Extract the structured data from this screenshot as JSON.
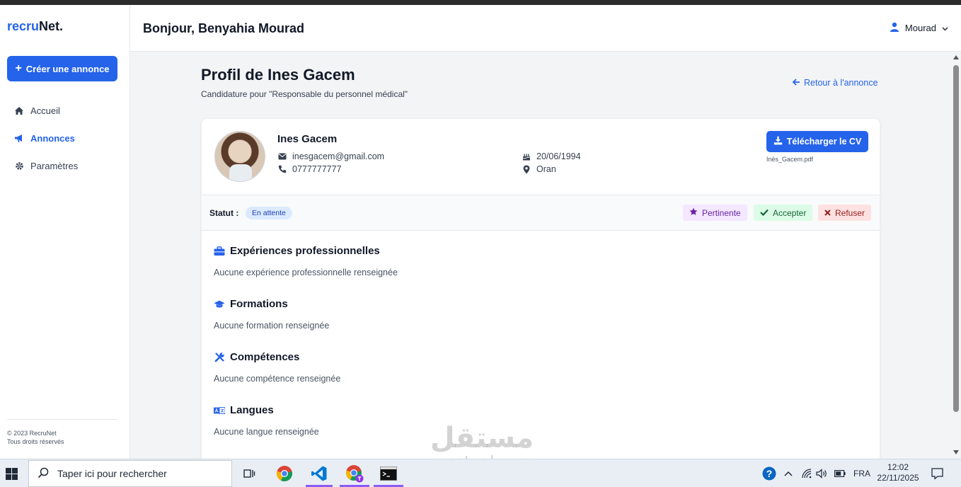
{
  "brand": {
    "part1": "recru",
    "part2": "Net."
  },
  "sidebar": {
    "create_label": "Créer une annonce",
    "items": [
      {
        "label": "Accueil",
        "icon": "home-icon"
      },
      {
        "label": "Annonces",
        "icon": "megaphone-icon",
        "active": true
      },
      {
        "label": "Paramètres",
        "icon": "gear-icon"
      }
    ],
    "footer_line1": "© 2023 RecruNet",
    "footer_line2": "Tous droits réservés"
  },
  "header": {
    "greeting": "Bonjour, Benyahia Mourad",
    "user": "Mourad"
  },
  "page": {
    "title": "Profil de Ines Gacem",
    "subtitle": "Candidature pour \"Responsable du personnel médical\"",
    "back_label": "Retour à l'annonce"
  },
  "candidate": {
    "name": "Ines Gacem",
    "email": "inesgacem@gmail.com",
    "phone": "0777777777",
    "birthdate": "20/06/1994",
    "city": "Oran",
    "download_label": "Télécharger le CV",
    "cv_file": "Inès_Gacem.pdf"
  },
  "status": {
    "label": "Statut :",
    "value": "En attente",
    "actions": {
      "pertinent": "Pertinente",
      "accept": "Accepter",
      "refuse": "Refuser"
    }
  },
  "sections": [
    {
      "title": "Expériences professionnelles",
      "empty": "Aucune expérience professionnelle renseignée",
      "icon": "briefcase-icon"
    },
    {
      "title": "Formations",
      "empty": "Aucune formation renseignée",
      "icon": "graduation-cap-icon"
    },
    {
      "title": "Compétences",
      "empty": "Aucune compétence renseignée",
      "icon": "tools-icon"
    },
    {
      "title": "Langues",
      "empty": "Aucune langue renseignée",
      "icon": "language-icon"
    }
  ],
  "taskbar": {
    "search_placeholder": "Taper ici pour rechercher",
    "language": "FRA",
    "time": "12:02",
    "date": "22/11/2025"
  },
  "watermark": {
    "arabic": "مستقل",
    "latin": "mostaql.com"
  },
  "colors": {
    "primary": "#2563eb",
    "badge_bg": "#dbeafe"
  }
}
